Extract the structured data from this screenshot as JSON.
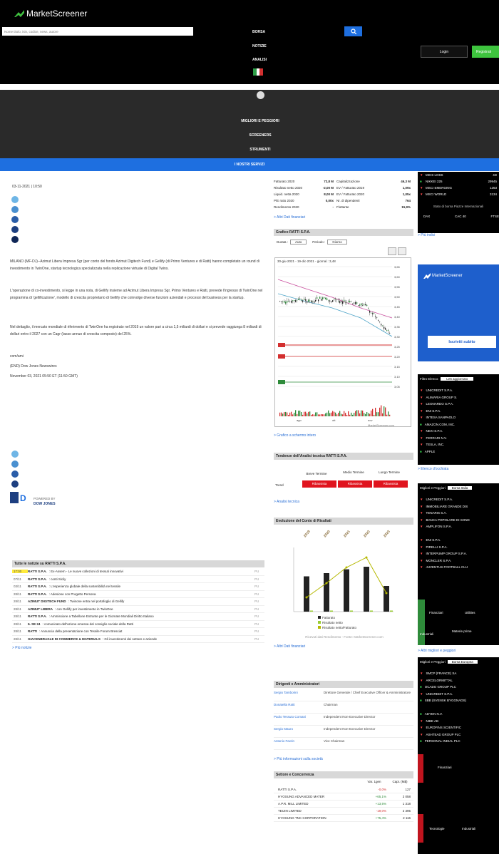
{
  "header": {
    "logo_text": "MarketScreener",
    "search_placeholder": "Nome titolo, isin, codice, news, autore",
    "nav": [
      "BORSA",
      "NOTIZIE",
      "ANALISI"
    ],
    "login": "Login",
    "register": "Registrati",
    "menu": [
      "MIGLIORI E PEGGIORI",
      "SCREENERS",
      "STRUMENTI",
      "I NOSTRI SERVIZI"
    ]
  },
  "article": {
    "date": "03-11-2021 | 10:50",
    "p1": "MILANO (MF-DJ)--Azimut Libera Impresa Sgr (per conto del fondo Azimut Digitech Fund) e Gellify (di Primo Ventures e di Ratti) hanno completato un round di investimento in TwinOne, startup tecnologica specializzata nella replicazione virtuale di Digital Twins.",
    "p2": "L'operazione di co-investimento, si legge in una nota, di Gellify insieme ad Azimut Libera Impresa Sgr, Primo Ventures e Ratti, prevede l'ingresso di TwinOne nel programma di 'gellificazione', modello di crescita proprietario di Gellify che coinvolge diverse funzioni aziendali e processi del business per la startup.",
    "p3": "Nel dettaglio, il mercato mondiale di riferimento di TwinOne ha registrato nel 2019 un valore pari a circa 1,5 miliardi di dollari e si prevede raggiunga 8 miliardi di dollari entro il 2027 con un Cagr (tasso annuo di crescita composto) del 25%.",
    "p4": "com/ami",
    "p5": "(END) Dow Jones Newswires",
    "p6": "November 03, 2021 05:50 ET (11:50 GMT)",
    "pub_by": "POWERED BY",
    "pub_name": "DOW JONES"
  },
  "news": {
    "title": "Tutte le notizie su RATTI S.P.A.",
    "items": [
      {
        "t": "17:00",
        "b": "RATTI S.P.A.",
        "h": ": Ex-Assem - Le nuove collezioni di tessuti innovativi",
        "s": "PU"
      },
      {
        "t": "07/11",
        "b": "RATTI S.P.A.",
        "h": ": conti Sicily",
        "s": "PU"
      },
      {
        "t": "03/11",
        "b": "RATTI S.P.A.",
        "h": ": L'esperienza globale della sostenibilità nel tessile",
        "s": "PU"
      },
      {
        "t": "28/11",
        "b": "RATTI S.P.A.",
        "h": ": Adesione con Progetto Persona",
        "s": "PU"
      },
      {
        "t": "28/11",
        "b": "AZIMUT DIGITECH FUND",
        "h": ": Twinone entra nel portafoglio di Gellify",
        "s": "PU"
      },
      {
        "t": "28/11",
        "b": "AZIMUT LIBERA",
        "h": ": con Gellify per investimento in TwinOne",
        "s": "PU"
      },
      {
        "t": "28/11",
        "b": "RATTI S.P.A.",
        "h": ": Ammissione a Tabellone Entrante per le Giornate Mondiali Diritto Italiano",
        "s": "PU"
      },
      {
        "t": "28/11",
        "b": "IL SE 24",
        "h": ": comunicato dell'azione emessa dal consiglio sociale della Ratti",
        "s": "PU"
      },
      {
        "t": "28/11",
        "b": "RATTI",
        "h": ": Annuncia della presentazione con Tessile Forum Bresciat",
        "s": "PU"
      },
      {
        "t": "28/11",
        "b": "GIACENBRAGLE DI COMMERCE & MATERIALS",
        "h": ": Gli investimenti dei settore e aziende",
        "s": "PU"
      }
    ],
    "more": "> Più notizie"
  },
  "fin": {
    "rows": [
      [
        "Fatturato 2020",
        "72,8 M",
        "Capitalizzazione",
        "46,3 M"
      ],
      [
        "Risultato netto 2020",
        "-2,00 M",
        "EV / Fatturato 2019",
        "1,09x"
      ],
      [
        "Liquid. netta 2020",
        "8,00 M",
        "EV / Fatturato 2020",
        "1,05x"
      ],
      [
        "P/E ratio 2020",
        "0,00x",
        "Nr. di dipendenti",
        "764"
      ],
      [
        "Rendimento 2020",
        "-",
        "Flottante",
        "15,9%"
      ]
    ],
    "more": "> Altri Dati finanziari"
  },
  "chart": {
    "title": "Grafico RATTI S.P.A.",
    "durata_lbl": "Durata :",
    "durata_val": "Auto",
    "periodo_lbl": "Periodo :",
    "periodo_val": "Giorno",
    "info": "30-giu-2021 - 19-dic-2021 - giornal.: 3,48",
    "more": "> Grafico a schermo intero",
    "credit": "MarketScreener.com",
    "yticks": [
      "3,65",
      "3,60",
      "3,55",
      "3,50",
      "3,45",
      "3,40",
      "3,35",
      "3,30",
      "3,25",
      "3,20",
      "3,15",
      "3,10",
      "3,05"
    ],
    "xticks": [
      "ago",
      "ott",
      "nov"
    ],
    "labels": [
      "3,46",
      "3,10",
      "3,2",
      "3,21"
    ]
  },
  "trend": {
    "title": "Tendenze dell'Analisi tecnica RATTI S.P.A.",
    "cols": [
      "Breve Termine",
      "Medio Termine",
      "Lungo Termine"
    ],
    "row_label": "Trend",
    "values": [
      "Ribassista",
      "Ribassista",
      "Ribassista"
    ],
    "more": "> Analisi tecnica"
  },
  "evo": {
    "title": "Evoluzione del Conto di Risultati",
    "chart_data": {
      "type": "bar",
      "categories": [
        "2019",
        "2020",
        "2021",
        "2022",
        "2023"
      ],
      "series": [
        {
          "name": "Fatturato",
          "values": [
            55,
            60,
            66,
            70,
            40
          ]
        },
        {
          "name": "Risultato netto",
          "values": [
            1,
            1,
            1,
            1,
            1
          ]
        },
        {
          "name": "Risultato netto/Fatturato",
          "values": [
            0.5,
            1.5,
            2.6,
            3.3,
            0.8
          ]
        }
      ],
      "ylim": [
        0,
        100
      ]
    },
    "credit": "Ricevuti dati Rendimento - Fonte: MarketScreener.com",
    "more": "> Altri Dati finanziari"
  },
  "mgmt": {
    "title": "Dirigenti e Amministratori",
    "rows": [
      [
        "Sergio Tamborini",
        "Direttore Generale / Chief Executive Officer & Amministratore"
      ],
      [
        "Donatella Ratti",
        "Chairman"
      ],
      [
        "Paolo Tessuto Comani",
        "Independent Non-Executive Director"
      ],
      [
        "Sergio Mauro",
        "Independent Non-Executive Director"
      ],
      [
        "Antonio Favrin",
        "Vice Chairman"
      ]
    ],
    "more": "> Più informazioni sulla società"
  },
  "sector": {
    "title": "Settore e Concorrenza",
    "cols": [
      "Var. 1gen",
      "Capi. (M$)"
    ],
    "rows": [
      [
        "RATTI S.P.A.",
        "-0,0%",
        "127"
      ],
      [
        "HYOSUNG ADVANCED MATER",
        "+65,1%",
        "2 058"
      ],
      [
        "A.P.R. MILL LIMITED",
        "+13,5%",
        "1 318"
      ],
      [
        "TEIJIN LIMITED",
        "-19,0%",
        "2 395"
      ],
      [
        "HYOSUNG TNC CORPORATION",
        "+75,4%",
        "2 116"
      ]
    ]
  },
  "sidebar": {
    "indices": [
      [
        "▼",
        "MICS LOSS",
        "4D"
      ],
      [
        "■",
        "NIKKEI 225",
        "29945"
      ],
      [
        "▼",
        "MSCI EMERGING",
        "1263"
      ],
      [
        "▼",
        "MSCI WORLD",
        "3134"
      ]
    ],
    "markets_title": "Stato di borsa Piazze Internazionali",
    "mkts": [
      "DAX",
      "CAC 40",
      "FTSE"
    ],
    "more_idx": "> Più indici",
    "ad_logo": "MarketScreener",
    "ad_btn": "Iscriviti subito",
    "filter_title": "Filtro Elenco:",
    "filter_val": "Lett aggiornato",
    "list1": [
      "▼ UNICREDIT S.P.A.",
      "▼ ALIMARIA GROUP S.",
      "▼ LEONARDO S.P.A.",
      "▼ ENI S.P.A.",
      "▼ INTESA SANPAOLO",
      "■ AMAZON.COM, INC.",
      "▼ NEXI S.P.A.",
      "▼ FERRARI N.V.",
      "▼ TESLA, INC.",
      "■ APPLE"
    ],
    "more1": "> Elenco d'occhiata",
    "best_title": "Migliori e Peggiori",
    "best_val": "Borsa Italia",
    "list2": [
      "▼ UNICREDIT S.P.A.",
      "▼ IMMOBILIARE GRANDE DIS",
      "▼ TENARIS S.A.",
      "▼ BANCA POPOLARE DI SOND",
      "▼ AMPLIFON S.P.A.",
      "",
      "▼ ENI S.P.A.",
      "▼ PIRELLI S.P.A.",
      "▼ INTERPUMP GROUP S.P.A.",
      "▼ MONCLER S.P.A.",
      "▼ JUVENTUS FOOTBALL CLU"
    ],
    "heat1": [
      "Finanziari",
      "Utilities",
      "Industriali",
      "Materie prime"
    ],
    "more2": "> Altri migliori e peggiori",
    "best2_title": "Migliori e Peggiori",
    "best2_val": "Borsa Europea",
    "list3": [
      "▼ SMCP (FRANCE) SA",
      "▼ ARCELORMITTAL",
      "■ OCADO GROUP PLC",
      "▼ UNICREDIT S.P.A.",
      "■ SBB (SVENSK BYGGNADS)",
      "",
      "■ ADYEN N.V.",
      "▼ NIBE AB",
      "▼ EUROFINS SCIENTIFIC",
      "▼ ASHTEAD GROUP PLC",
      "■ PERSONAL INDIAL PLC"
    ],
    "heat2": [
      "Finanziari",
      "Tecnologie",
      "Industriali"
    ]
  }
}
